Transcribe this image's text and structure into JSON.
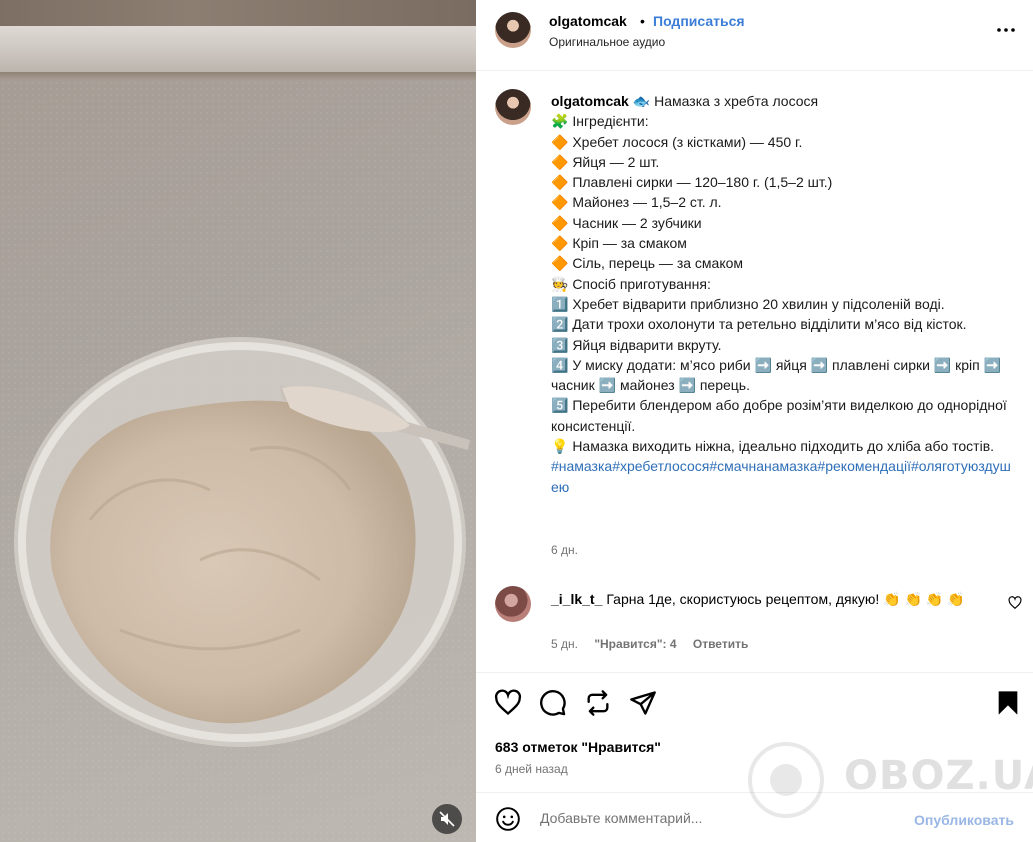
{
  "post": {
    "username": "olgatomcak",
    "dot": "•",
    "follow_label": "Подписаться",
    "audio_label": "Оригинальное аудио",
    "more_icon": "more-horizontal-icon"
  },
  "caption": {
    "username": "olgatomcak",
    "lines": [
      "🐟 Намазка з хребта лосося",
      "🧩 Інгредієнти:",
      "🔶 Хребет лосося (з кістками) — 450 г.",
      "🔶 Яйця — 2 шт.",
      "🔶 Плавлені сирки — 120–180 г. (1,5–2 шт.)",
      "🔶 Майонез — 1,5–2 ст. л.",
      "🔶 Часник — 2 зубчики",
      "🔶 Кріп — за смаком",
      "🔶 Сіль, перець — за смаком",
      "🧑‍🍳 Спосіб приготування:",
      "1️⃣ Хребет відварити приблизно 20 хвилин у підсоленій воді.",
      "2️⃣ Дати трохи охолонути та ретельно відділити м’ясо від кісток.",
      "3️⃣ Яйця відварити вкруту.",
      "4️⃣ У миску додати: м’ясо риби ➡️ яйця ➡️ плавлені сирки ➡️ кріп ➡️ часник ➡️ майонез ➡️ перець.",
      "5️⃣ Перебити блендером або добре розім’яти виделкою до однорідної консистенції.",
      "💡 Намазка виходить ніжна, ідеально підходить до хліба або тостів."
    ],
    "hashtags": "#намазка#хребетлосося#смачнанамазка#рекомендації#оляготуюздушею",
    "time": "6 дн."
  },
  "comment": {
    "username": "_i_lk_t_",
    "text": "Гарна 1де, скористуюсь рецептом, дякую! 👏 👏 👏 👏",
    "time": "5 дн.",
    "likes": "\"Нравится\": 4",
    "reply": "Ответить"
  },
  "actions": {
    "likes_count": "683 отметок \"Нравится\"",
    "date": "6 дней назад"
  },
  "add_comment": {
    "placeholder": "Добавьте комментарий...",
    "publish": "Опубликовать"
  },
  "watermark": {
    "text": "OBOZ.UA"
  },
  "colors": {
    "link": "#3b7dd8",
    "hashtag": "#2f6fb8",
    "muted": "#737373",
    "publish_disabled": "#9ab6e6"
  }
}
